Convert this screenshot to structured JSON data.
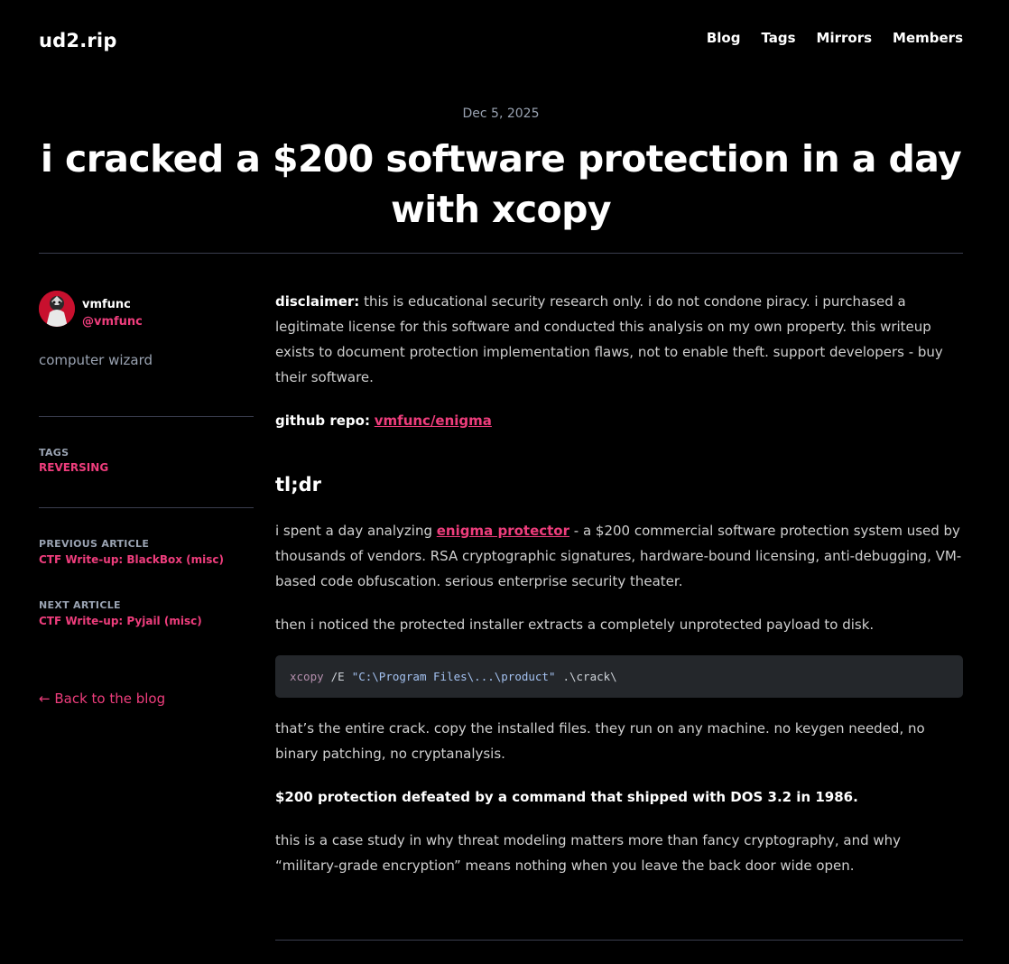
{
  "site": {
    "brand": "ud2.rip",
    "nav": [
      "Blog",
      "Tags",
      "Mirrors",
      "Members"
    ]
  },
  "post": {
    "date": "Dec 5, 2025",
    "title": "i cracked a $200 software protection in a day with xcopy"
  },
  "author": {
    "name": "vmfunc",
    "handle": "@vmfunc",
    "bio": "computer wizard"
  },
  "sidebar": {
    "tags_label": "TAGS",
    "tag": "REVERSING",
    "prev_label": "PREVIOUS ARTICLE",
    "prev_title": "CTF Write-up: BlackBox (misc)",
    "next_label": "NEXT ARTICLE",
    "next_title": "CTF Write-up: Pyjail (misc)",
    "back_link": "← Back to the blog"
  },
  "content": {
    "disclaimer_label": "disclaimer:",
    "disclaimer_text": " this is educational security research only. i do not condone piracy. i purchased a legitimate license for this software and conducted this analysis on my own property. this writeup exists to document protection implementation flaws, not to enable theft. support developers - buy their software.",
    "repo_label": "github repo:",
    "repo_link": "vmfunc/enigma",
    "tldr_heading": "tl;dr",
    "p1_before": "i spent a day analyzing ",
    "p1_link": "enigma protector",
    "p1_after": " - a $200 commercial software protection system used by thousands of vendors. RSA cryptographic signatures, hardware-bound licensing, anti-debugging, VM-based code obfuscation. serious enterprise security theater.",
    "p2": "then i noticed the protected installer extracts a completely unprotected payload to disk.",
    "code": {
      "cmd": "xcopy",
      "flag": "/E",
      "src": "\"C:\\Program Files\\...\\product\"",
      "dest": ".\\crack\\"
    },
    "p3": "that’s the entire crack. copy the installed files. they run on any machine. no keygen needed, no binary patching, no cryptanalysis.",
    "p4": "$200 protection defeated by a command that shipped with DOS 3.2 in 1986.",
    "p5": "this is a case study in why threat modeling matters more than fancy cryptography, and why “military-grade encryption” means nothing when you leave the back door wide open."
  },
  "colors": {
    "accent": "#ee3d7c",
    "muted": "#9aa3b2",
    "rule": "#3a3d4e",
    "code_bg": "#24272b"
  }
}
